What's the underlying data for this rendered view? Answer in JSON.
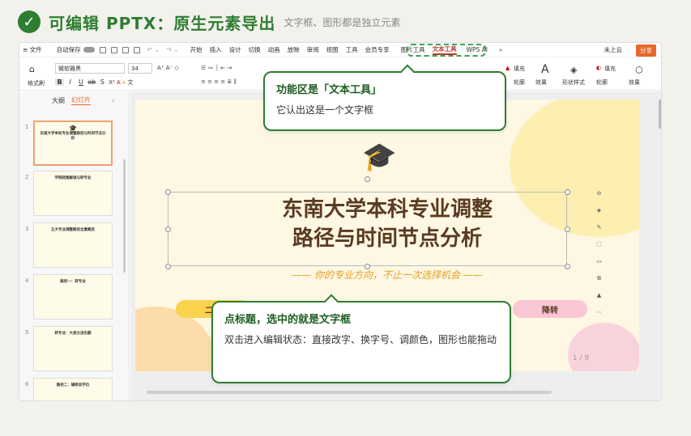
{
  "header": {
    "check": "✓",
    "title": "可编辑 PPTX：原生元素导出",
    "subtitle": "文字框、图形都是独立元素"
  },
  "menu": {
    "file": "≡ 文件",
    "autosave": "自动保存",
    "items": [
      "开始",
      "插入",
      "设计",
      "切换",
      "动画",
      "放映",
      "审阅",
      "视图",
      "工具",
      "会员专享"
    ],
    "picture_tool": "图片工具",
    "text_tool": "文本工具",
    "wps_ai": "WPS AI",
    "cloud": "未上云",
    "share": "分享"
  },
  "toolbar": {
    "format_painter": "格式刷",
    "font": "微软雅黑",
    "size": "34",
    "fill": "填充",
    "outline": "轮廓",
    "effect": "效果",
    "shape_style": "形状样式"
  },
  "sidebar": {
    "tab_outline": "大纲",
    "tab_slides": "幻灯片",
    "collapse": "‹",
    "thumbs": [
      {
        "num": "1",
        "title": "东南大学本科专业调整路径与时间节点分析"
      },
      {
        "num": "2",
        "title": "学院政策解读与转专业"
      },
      {
        "num": "3",
        "title": "五大专业调整路径全景概览"
      },
      {
        "num": "4",
        "title": "路径一：转专业"
      },
      {
        "num": "5",
        "title": "转专业：大类分流名额"
      },
      {
        "num": "6",
        "title": "路径二：辅修双学位"
      }
    ]
  },
  "slide": {
    "title_line1": "东南大学本科专业调整",
    "title_line2": "路径与时间节点分析",
    "subtitle": "—— 你的专业方向，不止一次选择机会 ——",
    "pill1": "二次",
    "pill2": "降转",
    "page": "1 / 9"
  },
  "callout1": {
    "title": "功能区是「文本工具」",
    "body": "它认出这是一个文字框"
  },
  "callout2": {
    "title": "点标题，选中的就是文字框",
    "body": "双击进入编辑状态：直接改字、换字号、调颜色，图形也能拖动"
  },
  "colors": {
    "accent": "#2e7d32",
    "brand": "#e8672a"
  }
}
